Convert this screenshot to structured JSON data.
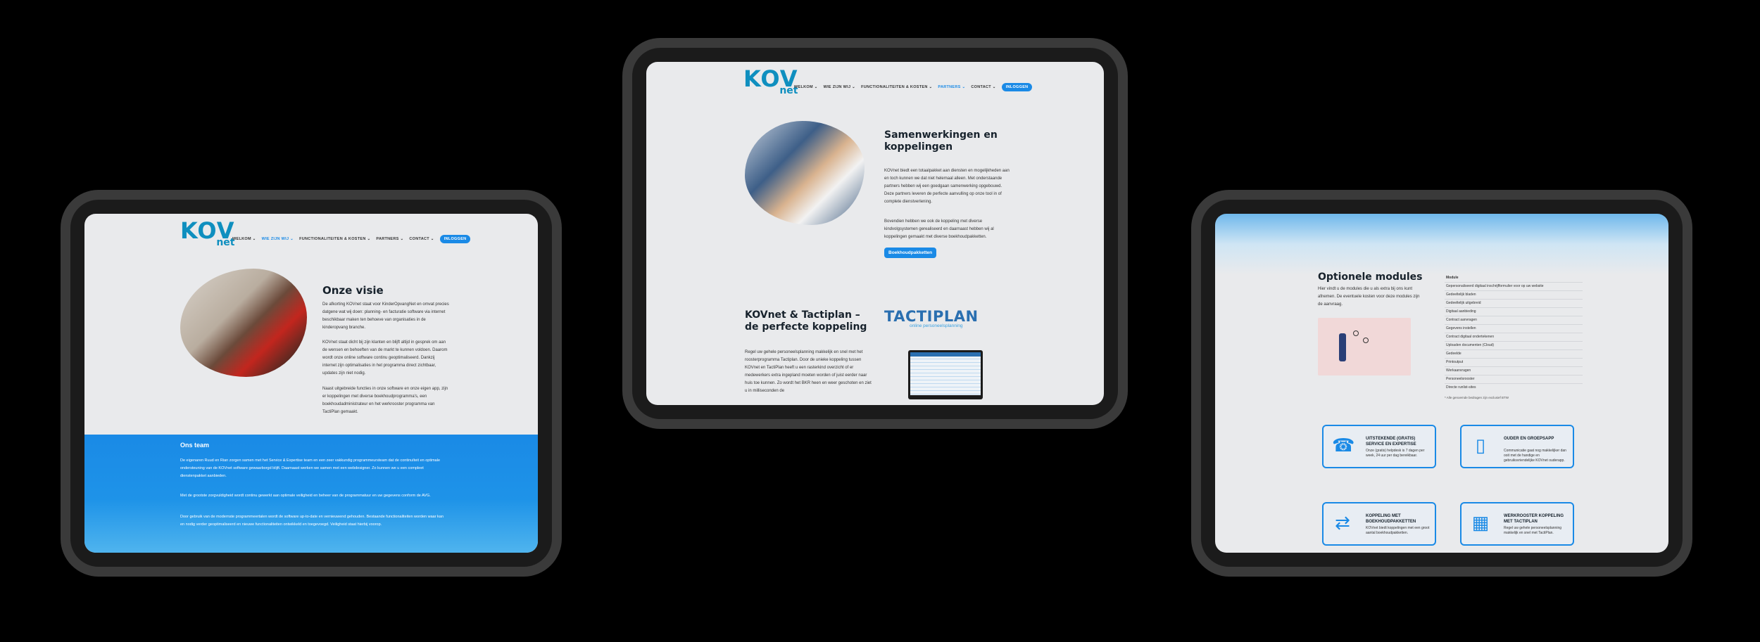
{
  "left": {
    "logo_main": "KOV",
    "logo_sub": "net",
    "nav": [
      "WELKOM ⌄",
      "WIE ZIJN WIJ ⌄",
      "FUNCTIONALITEITEN & KOSTEN ⌄",
      "PARTNERS ⌄",
      "CONTACT ⌄"
    ],
    "login": "INLOGGEN",
    "title": "Onze visie",
    "p1": "De afkorting KOVnet staat voor KinderOpvangNet en omvat precies datgene wat wij doen: planning- en facturatie software via internet beschikbaar maken ten behoeve van organisaties in de kinderopvang branche.",
    "p2": "KOVnet staat dicht bij zijn klanten en blijft altijd in gesprek om aan de wensen en behoeften van de markt te kunnen voldoen. Daarom wordt onze online software continu geoptimaliseerd. Dankzij internet zijn optimalisaties in het programma direct zichtbaar, updates zijn niet nodig.",
    "p3": "Naast uitgebreide functies in onze software en onze eigen app, zijn er koppelingen met diverse boekhoudprogramma's, een boekhoudadministrateur en het werkrooster programma van TactiPlan gemaakt.",
    "team_title": "Ons team",
    "team_p1": "De eigenaren Ruud en Rian zorgen samen met het Service & Expertise team en een zeer vakkundig programmeursteam dat de continuïteit en optimale ondersteuning van de KOVnet software gewaarborgd blijft. Daarnaast werken we samen met een webdesigner. Zo kunnen we u een compleet dienstenpakket aanbieden.",
    "team_p2": "Met de grootste zorgvuldigheid wordt continu gewerkt aan optimale veiligheid en beheer van de programmatuur en uw gegevens conform de AVG.",
    "team_p3": "Door gebruik van de modernste programmeertalen wordt de software up-to-date en vernieuwend gehouden. Bestaande functionaliteiten worden waar kan en nodig verder geoptimaliseerd en nieuwe functionaliteiten ontwikkeld en toegevoegd. Veiligheid staat hierbij voorop."
  },
  "center": {
    "nav": [
      "WELKOM ⌄",
      "WIE ZIJN WIJ ⌄",
      "FUNCTIONALITEITEN & KOSTEN ⌄",
      "PARTNERS ⌄",
      "CONTACT ⌄"
    ],
    "login": "INLOGGEN",
    "title": "Samenwerkingen en koppelingen",
    "p1": "KOVnet biedt een totaalpakket aan diensten en mogelijkheden aan en toch kunnen we dat niet helemaal alleen. Met onderstaande partners hebben wij een goedgaan samenwerking opgebouwd. Deze partners leveren de perfecte aanvulling op onze tool in of complete dienstverlening.",
    "p2": "Bovendien hebben we ook de koppeling met diverse kindvolgsystemen gerealiseerd en daarnaast hebben wij al koppelingen gemaakt met diverse boekhoudpakketten.",
    "button": "Boekhoudpakketten",
    "title2": "KOVnet & Tactiplan – de perfecte koppeling",
    "p3": "Regel uw gehele personeelsplanning makkelijk en snel met het roosterprogramma Tactiplan. Door de unieke koppeling tussen KOVnet en TactiPlan heeft u een rasterkind overzicht of er medewerkers extra ingepland moeten worden of juist eerder naar huis toe kunnen. Zo wordt het BKR heen en weer geschoten en ziet u in milliseconden de",
    "tacti_logo": "TACTIPLAN",
    "tacti_sub": "online personeelsplanning"
  },
  "right": {
    "title": "Optionele modules",
    "intro": "Hier vindt u de modules die u als extra bij ons kunt afnemen. De eventuele kosten voor deze modules zijn de aanvraag.",
    "table_header": "Module",
    "modules": [
      "Gepersonaliseerd digitaal inschrijfformulier voor op uw website",
      "Gedeeltelijk bladen",
      "Gedeeltelijk uitgebreid",
      "Digitaal aanbieding",
      "Contract aanvragen",
      "Gegevens instellen",
      "Contract digitaal ondertekenen",
      "Uploaden documenten (Cloud)",
      "Gedeelde",
      "Printoutput",
      "Werkaanvragen",
      "Personeelsrooster",
      "Directe runlist-sites"
    ],
    "table_note": "* Alle genoemde bedragen zijn exclusief BTW",
    "features": [
      {
        "title": "UITSTEKENDE (GRATIS) SERVICE EN EXPERTISE",
        "desc": "Onze (gratis) helpdesk is 7 dagen per week, 24 uur per dag bereikbaar."
      },
      {
        "title": "OUDER EN GROEPSAPP",
        "desc": "Communicatie gaat nog makkelijker dan ooit met de handige en gebruiksvriendelijke KOVnet ouderapp."
      },
      {
        "title": "KOPPELING MET BOEKHOUDPAKKETTEN",
        "desc": "KOVnet biedt koppelingen met een groot aantal boekhoudpakketten."
      },
      {
        "title": "WERKROOSTER KOPPELING MET TACTIPLAN",
        "desc": "Regel uw gehele personeelsplanning makkelijk en snel met TactiPlan."
      }
    ]
  },
  "colors": {
    "accent": "#1a8ae6",
    "logo": "#0f8fbf",
    "page_bg": "#e9eaec"
  }
}
